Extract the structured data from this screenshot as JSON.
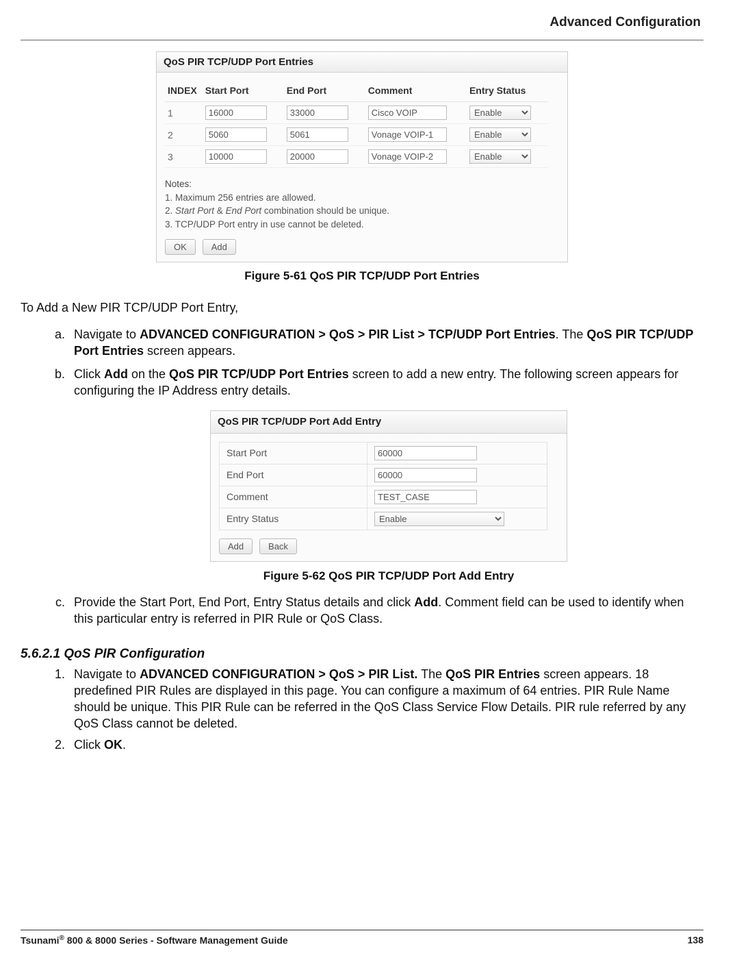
{
  "header": {
    "title": "Advanced Configuration"
  },
  "panel1": {
    "title": "QoS PIR TCP/UDP Port Entries",
    "headers": {
      "index": "INDEX",
      "start": "Start Port",
      "end": "End Port",
      "comment": "Comment",
      "status": "Entry Status"
    },
    "rows": [
      {
        "index": "1",
        "start": "16000",
        "end": "33000",
        "comment": "Cisco VOIP",
        "status": "Enable"
      },
      {
        "index": "2",
        "start": "5060",
        "end": "5061",
        "comment": "Vonage VOIP-1",
        "status": "Enable"
      },
      {
        "index": "3",
        "start": "10000",
        "end": "20000",
        "comment": "Vonage VOIP-2",
        "status": "Enable"
      }
    ],
    "notes": {
      "label": "Notes:",
      "n1": "1. Maximum 256 entries are allowed.",
      "n2_pre": "2. ",
      "n2_i1": "Start Port",
      "n2_mid": " & ",
      "n2_i2": "End Port",
      "n2_post": " combination should be unique.",
      "n3": "3. TCP/UDP Port entry in use cannot be deleted."
    },
    "buttons": {
      "ok": "OK",
      "add": "Add"
    }
  },
  "figcap1": "Figure 5-61 QoS PIR TCP/UDP Port Entries",
  "lead": "To Add a New PIR TCP/UDP Port Entry,",
  "step_a": {
    "p1_pre": "Navigate to ",
    "p1_b": "ADVANCED CONFIGURATION > QoS > PIR List > TCP/UDP Port Entries",
    "p1_mid": ". The ",
    "p1_b2": "QoS PIR TCP/UDP Port Entries",
    "p1_post": " screen appears."
  },
  "step_b": {
    "pre": "Click ",
    "b1": "Add",
    "mid": " on the ",
    "b2": "QoS PIR TCP/UDP Port Entries",
    "post": " screen to add a new entry. The following screen appears for configuring the IP Address entry details."
  },
  "panel2": {
    "title": "QoS PIR TCP/UDP Port Add Entry",
    "rows": {
      "start": {
        "label": "Start Port",
        "value": "60000"
      },
      "end": {
        "label": "End Port",
        "value": "60000"
      },
      "comment": {
        "label": "Comment",
        "value": "TEST_CASE"
      },
      "status": {
        "label": "Entry Status",
        "value": "Enable"
      }
    },
    "buttons": {
      "add": "Add",
      "back": "Back"
    }
  },
  "figcap2": "Figure 5-62 QoS PIR TCP/UDP Port Add Entry",
  "step_c": {
    "pre": "Provide the Start Port, End Port, Entry Status details and click ",
    "b": "Add",
    "post": ". Comment field can be used to identify when this particular entry is referred in PIR Rule or QoS Class."
  },
  "section562": "5.6.2.1 QoS PIR Configuration",
  "step1": {
    "pre": "Navigate to ",
    "b1": "ADVANCED CONFIGURATION > QoS > PIR List.",
    "mid": " The ",
    "b2": "QoS PIR Entries",
    "post": " screen appears. 18 predefined PIR Rules are displayed in this page. You can configure a maximum of 64 entries. PIR Rule Name should be unique. This PIR Rule can be referred in the QoS Class Service Flow Details. PIR rule referred by any QoS Class cannot be deleted."
  },
  "step2": {
    "pre": "Click ",
    "b": "OK",
    "post": "."
  },
  "footer": {
    "left_pre": "Tsunami",
    "left_sup": "®",
    "left_post": " 800 & 8000 Series - Software Management Guide",
    "page": "138"
  }
}
